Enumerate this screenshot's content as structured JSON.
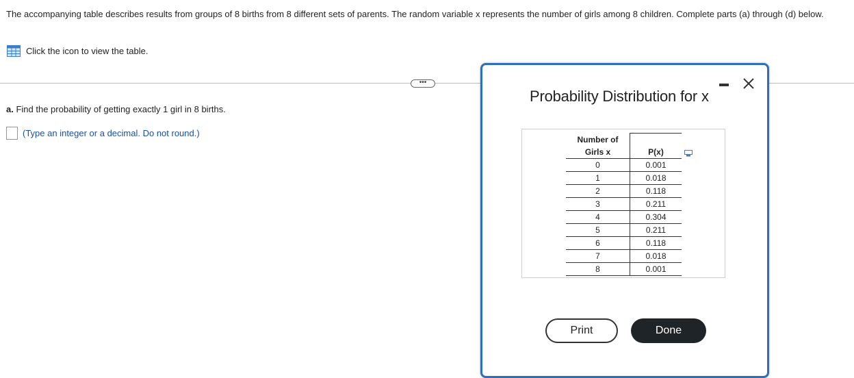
{
  "intro": {
    "text": "The accompanying table describes results from groups of 8 births from 8 different sets of parents. The random variable x represents the number of girls among 8 children. Complete parts (a) through (d) below."
  },
  "table_link": {
    "icon": "table-grid-icon",
    "label": "Click the icon to view the table."
  },
  "ellipsis_label": "•••",
  "question": {
    "part": "a.",
    "text": "Find the probability of getting exactly 1 girl in 8 births."
  },
  "answer": {
    "value": "",
    "hint": "(Type an integer or a decimal. Do not round.)"
  },
  "modal": {
    "title": "Probability Distribution for x",
    "minimize_icon": "minimize-icon",
    "close_icon": "close-icon",
    "copy_icon": "copy-icon",
    "table": {
      "headers": [
        "Number of Girls x",
        "P(x)"
      ],
      "header_line1": "Number of",
      "header_line2": "Girls x",
      "header_px": "P(x)",
      "rows": [
        [
          "0",
          "0.001"
        ],
        [
          "1",
          "0.018"
        ],
        [
          "2",
          "0.118"
        ],
        [
          "3",
          "0.211"
        ],
        [
          "4",
          "0.304"
        ],
        [
          "5",
          "0.211"
        ],
        [
          "6",
          "0.118"
        ],
        [
          "7",
          "0.018"
        ],
        [
          "8",
          "0.001"
        ]
      ]
    },
    "print_label": "Print",
    "done_label": "Done"
  },
  "colors": {
    "accent": "#2f6fb8",
    "hint_text": "#1b4f9c",
    "done_bg": "#1f2428"
  }
}
